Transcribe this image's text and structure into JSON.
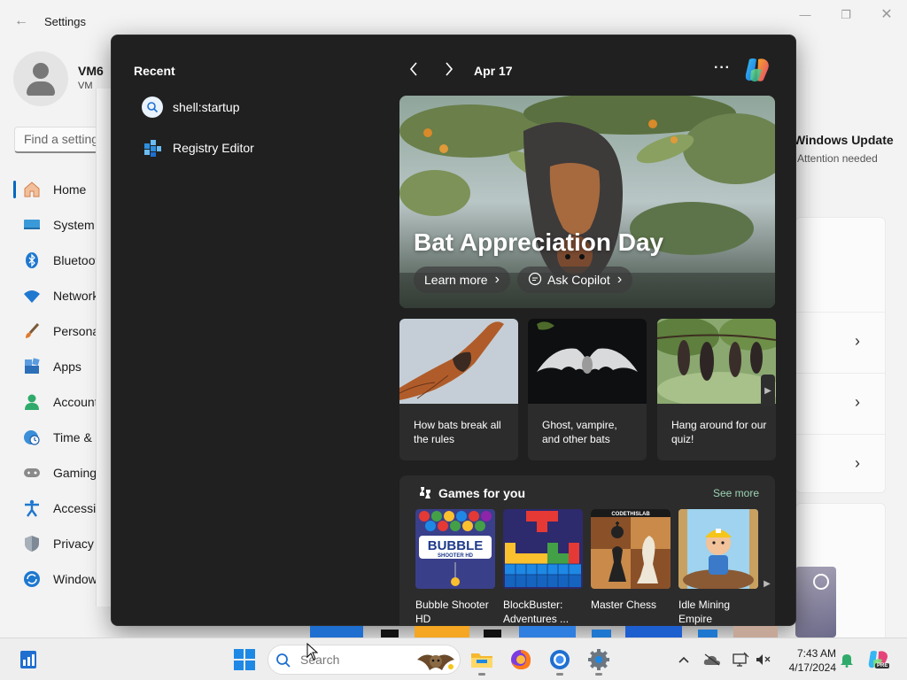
{
  "settings": {
    "title": "Settings",
    "profile_name": "VM6",
    "profile_sub": "VM",
    "search_placeholder": "Find a setting",
    "nav": [
      {
        "label": "Home",
        "icon": "home-icon"
      },
      {
        "label": "System",
        "icon": "system-icon"
      },
      {
        "label": "Bluetooth & devices",
        "icon": "bluetooth-icon"
      },
      {
        "label": "Network & internet",
        "icon": "wifi-icon"
      },
      {
        "label": "Personalization",
        "icon": "brush-icon"
      },
      {
        "label": "Apps",
        "icon": "apps-icon"
      },
      {
        "label": "Accounts",
        "icon": "account-icon"
      },
      {
        "label": "Time & language",
        "icon": "clock-globe-icon"
      },
      {
        "label": "Gaming",
        "icon": "gamepad-icon"
      },
      {
        "label": "Accessibility",
        "icon": "accessibility-icon"
      },
      {
        "label": "Privacy & security",
        "icon": "shield-icon"
      },
      {
        "label": "Windows Update",
        "icon": "update-icon"
      }
    ],
    "update_title": "Windows Update",
    "update_sub": "Attention needed"
  },
  "start": {
    "recent_heading": "Recent",
    "recent": [
      {
        "label": "shell:startup",
        "icon": "search-icon"
      },
      {
        "label": "Registry Editor",
        "icon": "registry-editor-icon"
      }
    ],
    "date": "Apr 17",
    "hero": {
      "title": "Bat Appreciation Day",
      "learn_more": "Learn more",
      "ask_copilot": "Ask Copilot"
    },
    "news": [
      {
        "caption": "How bats break all the rules"
      },
      {
        "caption": "Ghost, vampire, and other bats"
      },
      {
        "caption": "Hang around for our quiz!"
      }
    ],
    "games": {
      "title": "Games for you",
      "see_more": "See more",
      "items": [
        {
          "name": "Bubble Shooter HD",
          "line1": "Bubble Shooter",
          "line2": "HD"
        },
        {
          "name": "BlockBuster: Adventures ...",
          "line1": "BlockBuster:",
          "line2": "Adventures ..."
        },
        {
          "name": "Master Chess",
          "line1": "Master Chess",
          "line2": ""
        },
        {
          "name": "Idle Mining Empire",
          "line1": "Idle Mining",
          "line2": "Empire"
        }
      ],
      "tile_text": {
        "bubble_1": "BUBBLE",
        "bubble_2": "SHOOTER HD",
        "chess_banner": "CODETHISLAB"
      }
    }
  },
  "taskbar": {
    "search_placeholder": "Search",
    "time": "7:43 AM",
    "date": "4/17/2024",
    "copilot_badge": "PRE"
  }
}
